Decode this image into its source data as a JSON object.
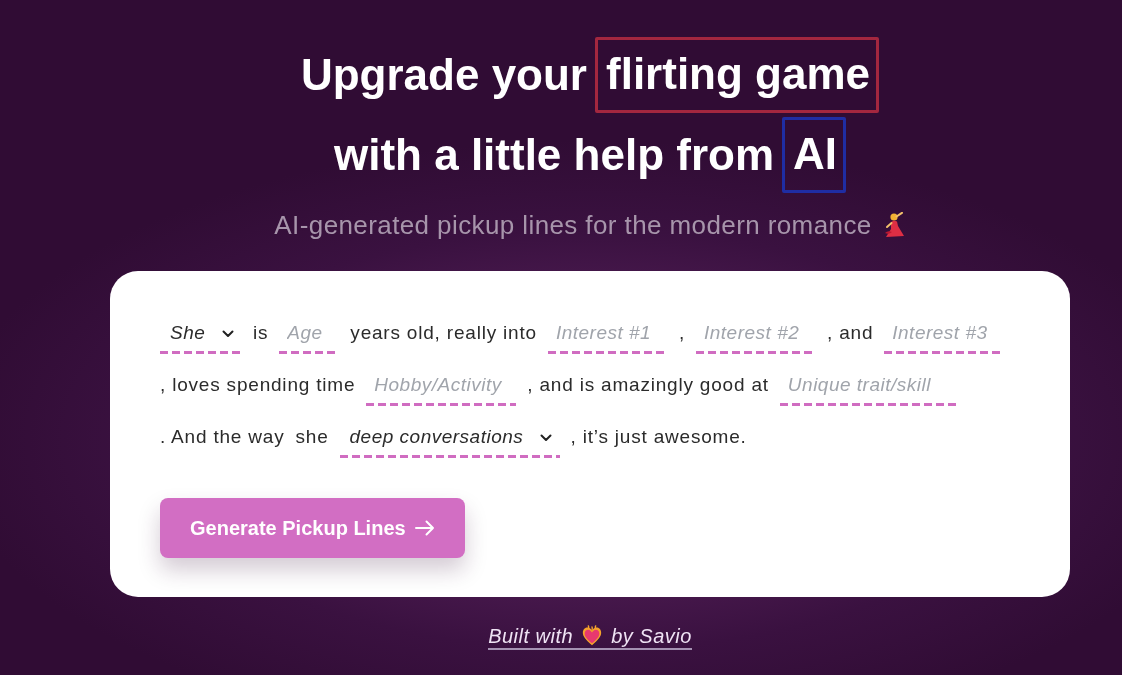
{
  "heading": {
    "lines": [
      {
        "text": "Upgrade your",
        "highlight": {
          "text": "flirting game",
          "color": "#a3273f"
        }
      },
      {
        "text": "with a little help from",
        "highlight": {
          "text": "AI",
          "color": "#1f2da3"
        }
      }
    ]
  },
  "subtitle": "AI-generated pickup lines for the modern romance",
  "form": {
    "sentence": [
      {
        "kind": "select",
        "value": "She"
      },
      {
        "kind": "text",
        "text": "is"
      },
      {
        "kind": "input",
        "placeholder": "Age"
      },
      {
        "kind": "text",
        "text": "years old, really into"
      },
      {
        "kind": "input",
        "placeholder": "Interest #1"
      },
      {
        "kind": "text",
        "text": ","
      },
      {
        "kind": "input",
        "placeholder": "Interest #2"
      },
      {
        "kind": "text",
        "text": ", and"
      },
      {
        "kind": "input",
        "placeholder": "Interest #3"
      },
      {
        "kind": "text",
        "text": ", loves spending time"
      },
      {
        "kind": "input",
        "placeholder": "Hobby/Activity"
      },
      {
        "kind": "text",
        "text": ", and is amazingly good at"
      },
      {
        "kind": "input",
        "placeholder": "Unique trait/skill"
      },
      {
        "kind": "text",
        "text": ". And the way"
      },
      {
        "kind": "text",
        "text": "she"
      },
      {
        "kind": "select",
        "value": "deep conversations"
      },
      {
        "kind": "text",
        "text": ", it’s just awesome."
      }
    ],
    "button": {
      "label": "Generate Pickup Lines"
    }
  },
  "footer": {
    "credit_link": {
      "text_before": "Built with",
      "text_after": "by Savio"
    }
  }
}
